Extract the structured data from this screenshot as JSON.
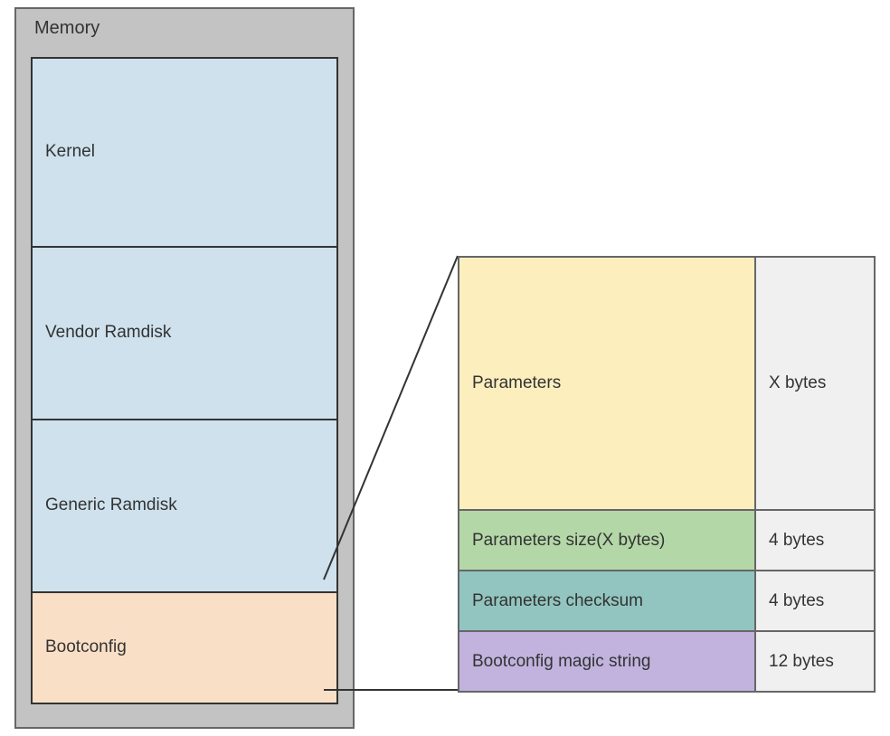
{
  "memory": {
    "title": "Memory",
    "blocks": {
      "kernel": "Kernel",
      "vendor": "Vendor Ramdisk",
      "generic": "Generic Ramdisk",
      "bootconfig": "Bootconfig"
    }
  },
  "detail": {
    "parameters": {
      "label": "Parameters",
      "size": "X bytes"
    },
    "paramsSize": {
      "label": "Parameters size(X bytes)",
      "size": "4 bytes"
    },
    "checksum": {
      "label": "Parameters checksum",
      "size": "4 bytes"
    },
    "magic": {
      "label": "Bootconfig magic string",
      "size": "12 bytes"
    }
  }
}
